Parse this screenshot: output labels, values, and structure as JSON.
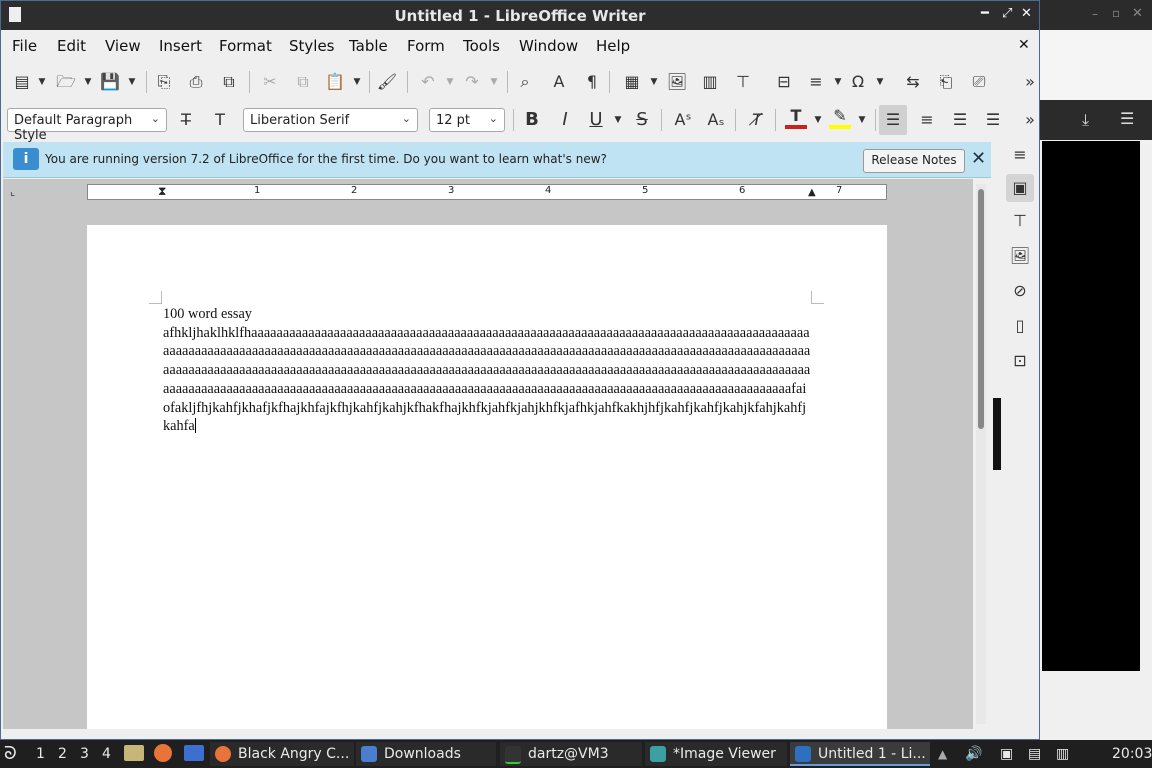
{
  "window": {
    "title": "Untitled 1 - LibreOffice Writer"
  },
  "menu": [
    "File",
    "Edit",
    "View",
    "Insert",
    "Format",
    "Styles",
    "Table",
    "Form",
    "Tools",
    "Window",
    "Help"
  ],
  "formatting": {
    "paragraph_style": "Default Paragraph Style",
    "font_name": "Liberation Serif",
    "font_size": "12 pt"
  },
  "infobar": {
    "message": "You are running version 7.2 of LibreOffice for the first time. Do you want to learn what's new?",
    "button": "Release Notes"
  },
  "ruler": {
    "ticks": [
      "1",
      "2",
      "3",
      "4",
      "5",
      "6",
      "7"
    ]
  },
  "document": {
    "title_line": "100 word essay",
    "body": "afhkljhaklhklfhaaaaaaaaaaaaaaaaaaaaaaaaaaaaaaaaaaaaaaaaaaaaaaaaaaaaaaaaaaaaaaaaaaaaaaaaaaaaaaaaaaaaaaaaaaaaaaaaaaaaaaaaaaaaaaaaaaaaaaaaaaaaaaaaaaaaaaaaaaaaaaaaaaaaaaaaaaaaaaaaaaaaaaaaaaaaaaaaaaaaaaaaaaaaaaaaaaaaaaaaaaaaaaaaaaaaaaaaaaaaaaaaaaaaaaaaaaaaaaaaaaaaaaaaaaaaaaaaaaaaaaaaaaaaaaaaaaaaaaaaaaaaaaaaaaaaaaaaaaaaaaaaaaaaaaaaaaaaaaaaaaaaaaaaaaaaaaaaaaaaaaaaaaaaaaaaaaaaaaaaaaaaaaaaaaaaaaaaaaaaaaaaaaaaaaafaiofakljfhjkahfjkhafjkfhajkhfajkfhjkahfjkahjkfhakfhajkhfkjahfkjahjkhfkjafhkjahfkakhjhfjkahfjkahfjkahjkfahjkahfjkahfa"
  },
  "taskbar": {
    "workspaces": [
      "1",
      "2",
      "3",
      "4"
    ],
    "tasks": [
      {
        "label": "Black Angry C...",
        "color": "#e8743a"
      },
      {
        "label": "Downloads",
        "color": "#4a7fd0"
      },
      {
        "label": "dartz@VM3",
        "color": "#333333"
      },
      {
        "label": "*Image Viewer",
        "color": "#3aa0a0"
      },
      {
        "label": "Untitled 1 - Li...",
        "color": "#2f6fc0"
      }
    ],
    "clock": "20:03"
  }
}
